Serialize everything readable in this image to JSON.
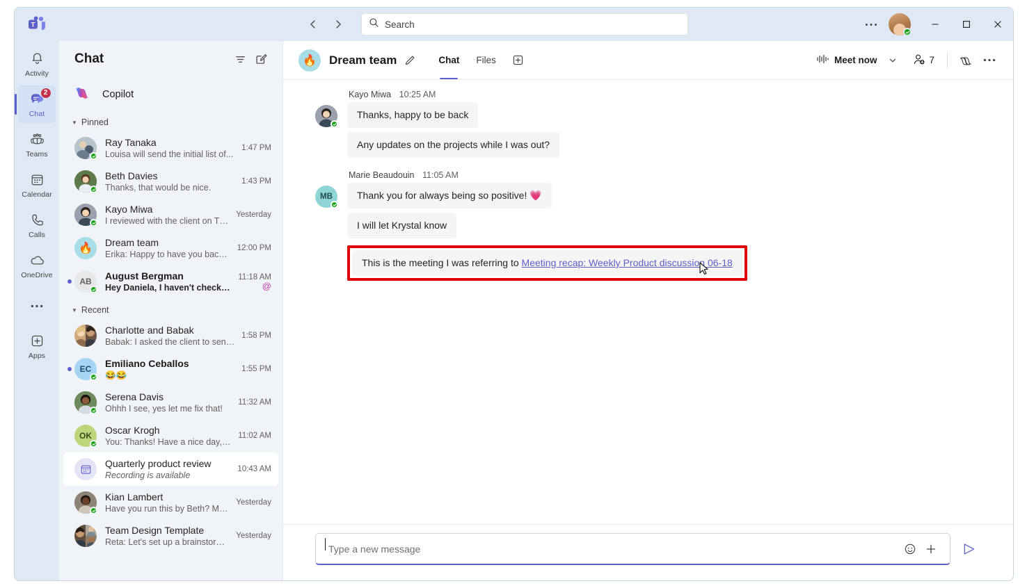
{
  "titlebar": {
    "back_label": "Back",
    "forward_label": "Forward",
    "search_placeholder": "Search",
    "more_label": "Settings and more",
    "minimize_label": "Minimize",
    "maximize_label": "Maximize",
    "close_label": "Close",
    "app_name": "Microsoft Teams"
  },
  "rail": {
    "items": [
      {
        "label": "Activity",
        "icon": "bell-icon",
        "badge": "",
        "active": false
      },
      {
        "label": "Chat",
        "icon": "chat-icon",
        "badge": "2",
        "active": true
      },
      {
        "label": "Teams",
        "icon": "teams-icon",
        "badge": "",
        "active": false
      },
      {
        "label": "Calendar",
        "icon": "calendar-icon",
        "badge": "",
        "active": false
      },
      {
        "label": "Calls",
        "icon": "phone-icon",
        "badge": "",
        "active": false
      },
      {
        "label": "OneDrive",
        "icon": "cloud-icon",
        "badge": "",
        "active": false
      },
      {
        "label": "",
        "icon": "more-icon",
        "badge": "",
        "active": false
      },
      {
        "label": "Apps",
        "icon": "apps-plus-icon",
        "badge": "",
        "active": false
      }
    ]
  },
  "chatlist": {
    "title": "Chat",
    "filter_label": "Filter",
    "compose_label": "New chat",
    "copilot": {
      "label": "Copilot"
    },
    "groups": [
      {
        "label": "Pinned",
        "items": [
          {
            "name": "Ray Tanaka",
            "preview": "Louisa will send the initial list of...",
            "time": "1:47 PM",
            "unread": false,
            "bold": false,
            "mention": false,
            "avatar_type": "photo",
            "avatar_color": "#9aa7b0",
            "initials": "",
            "presence": true,
            "selected": false
          },
          {
            "name": "Beth Davies",
            "preview": "Thanks, that would be nice.",
            "time": "1:43 PM",
            "unread": false,
            "bold": false,
            "mention": false,
            "avatar_type": "photo",
            "avatar_color": "#6b8e5a",
            "initials": "",
            "presence": true,
            "selected": false
          },
          {
            "name": "Kayo Miwa",
            "preview": "I reviewed with the client on Th...",
            "time": "Yesterday",
            "unread": false,
            "bold": false,
            "mention": false,
            "avatar_type": "photo",
            "avatar_color": "#8c8c9e",
            "initials": "",
            "presence": true,
            "selected": false
          },
          {
            "name": "Dream team",
            "preview": "Erika: Happy to have you back,...",
            "time": "12:00 PM",
            "unread": false,
            "bold": false,
            "mention": false,
            "avatar_type": "emoji",
            "avatar_color": "#a8dde8",
            "initials": "🔥",
            "presence": false,
            "selected": false
          },
          {
            "name": "August Bergman",
            "preview": "Hey Daniela, I haven't checked...",
            "time": "11:18 AM",
            "unread": true,
            "bold": true,
            "mention": true,
            "avatar_type": "initials",
            "avatar_color": "#e8e8e8",
            "initials": "AB",
            "presence": true,
            "selected": false
          }
        ]
      },
      {
        "label": "Recent",
        "items": [
          {
            "name": "Charlotte and Babak",
            "preview": "Babak: I asked the client to send...",
            "time": "1:58 PM",
            "unread": false,
            "bold": false,
            "mention": false,
            "avatar_type": "split",
            "avatar_color": "#c9a27e",
            "initials": "",
            "presence": false,
            "selected": false
          },
          {
            "name": "Emiliano Ceballos",
            "preview": "😂😂",
            "time": "1:55 PM",
            "unread": true,
            "bold": true,
            "mention": false,
            "avatar_type": "initials",
            "avatar_color": "#a6d5f2",
            "initials": "EC",
            "presence": true,
            "selected": false
          },
          {
            "name": "Serena Davis",
            "preview": "Ohhh I see, yes let me fix that!",
            "time": "11:32 AM",
            "unread": false,
            "bold": false,
            "mention": false,
            "avatar_type": "photo",
            "avatar_color": "#5e4b3c",
            "initials": "",
            "presence": true,
            "selected": false
          },
          {
            "name": "Oscar Krogh",
            "preview": "You: Thanks! Have a nice day, I...",
            "time": "11:02 AM",
            "unread": false,
            "bold": false,
            "mention": false,
            "avatar_type": "initials",
            "avatar_color": "#bdd67a",
            "initials": "OK",
            "presence": true,
            "selected": false
          },
          {
            "name": "Quarterly product review",
            "preview": "Recording is available",
            "time": "10:43 AM",
            "unread": false,
            "bold": false,
            "mention": false,
            "avatar_type": "meeting",
            "avatar_color": "#e4e4f6",
            "initials": "",
            "presence": false,
            "selected": true,
            "italic": true
          },
          {
            "name": "Kian Lambert",
            "preview": "Have you run this by Beth? Mak...",
            "time": "Yesterday",
            "unread": false,
            "bold": false,
            "mention": false,
            "avatar_type": "photo",
            "avatar_color": "#736154",
            "initials": "",
            "presence": true,
            "selected": false
          },
          {
            "name": "Team Design Template",
            "preview": "Reta: Let's set up a brainstormi...",
            "time": "Yesterday",
            "unread": false,
            "bold": false,
            "mention": false,
            "avatar_type": "splitv",
            "avatar_color": "#8a7162",
            "initials": "",
            "presence": false,
            "selected": false
          }
        ]
      }
    ]
  },
  "conversation": {
    "title": "Dream team",
    "avatar_emoji": "🔥",
    "edit_label": "Edit name",
    "tabs": [
      {
        "label": "Chat",
        "active": true
      },
      {
        "label": "Files",
        "active": false
      }
    ],
    "add_tab_label": "Add a tab",
    "meet_now_label": "Meet now",
    "meet_caret_label": "Meeting options",
    "people_count": "7",
    "people_label": "Add people",
    "copilot_label": "Copilot",
    "more_label": "More options"
  },
  "messages": [
    {
      "sender": "Kayo Miwa",
      "time": "10:25 AM",
      "avatar_type": "photo",
      "avatar_color": "#8c8c9e",
      "initials": "",
      "presence": true,
      "bubbles": [
        {
          "text": "Thanks, happy to be back",
          "highlighted": false,
          "link": ""
        },
        {
          "text": "Any updates on the projects while I was out?",
          "highlighted": false,
          "link": ""
        }
      ]
    },
    {
      "sender": "Marie Beaudouin",
      "time": "11:05 AM",
      "avatar_type": "initials",
      "avatar_color": "#8fd5d5",
      "initials": "MB",
      "presence": true,
      "bubbles": [
        {
          "text": "Thank you for always being so positive! 💗",
          "highlighted": false,
          "link": ""
        },
        {
          "text": "I will let Krystal know",
          "highlighted": false,
          "link": ""
        },
        {
          "text": "This is the meeting I was referring to ",
          "highlighted": true,
          "link": "Meeting recap: Weekly Product discussion 06-18"
        }
      ]
    }
  ],
  "composer": {
    "placeholder": "Type a new message",
    "emoji_label": "Emoji",
    "plus_label": "More options",
    "send_label": "Send"
  },
  "colors": {
    "accent": "#5b5fc7",
    "badge": "#c4314b",
    "presence_green": "#13a10e",
    "mention": "#c239b3",
    "highlight": "#e00000",
    "rail_bg": "#dfe9f5",
    "list_bg": "#f0f4f9"
  }
}
